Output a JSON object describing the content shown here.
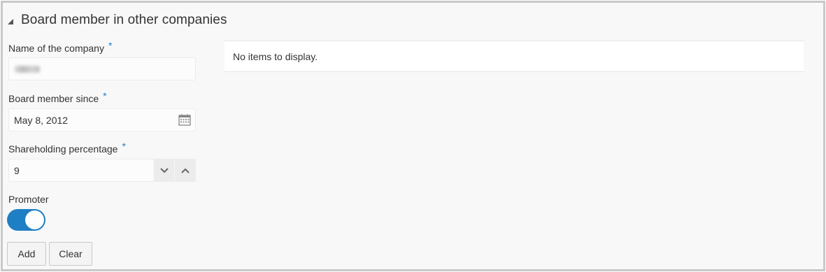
{
  "section": {
    "title": "Board member in other companies"
  },
  "form": {
    "company": {
      "label": "Name of the company",
      "required_marker": "*"
    },
    "since": {
      "label": "Board member since",
      "required_marker": "*",
      "value": "May 8, 2012"
    },
    "shareholding": {
      "label": "Shareholding percentage",
      "required_marker": "*",
      "value": "9"
    },
    "promoter": {
      "label": "Promoter",
      "state": "on"
    }
  },
  "actions": {
    "add_label": "Add",
    "clear_label": "Clear"
  },
  "table": {
    "empty_text": "No items to display."
  },
  "colors": {
    "accent": "#1e7fc4",
    "required": "#1f7fc7",
    "background": "#f8f8f8"
  },
  "icons": {
    "collapse": "triangle-collapse-icon",
    "calendar": "calendar-icon",
    "decrement": "chevron-down-icon",
    "increment": "chevron-up-icon"
  }
}
